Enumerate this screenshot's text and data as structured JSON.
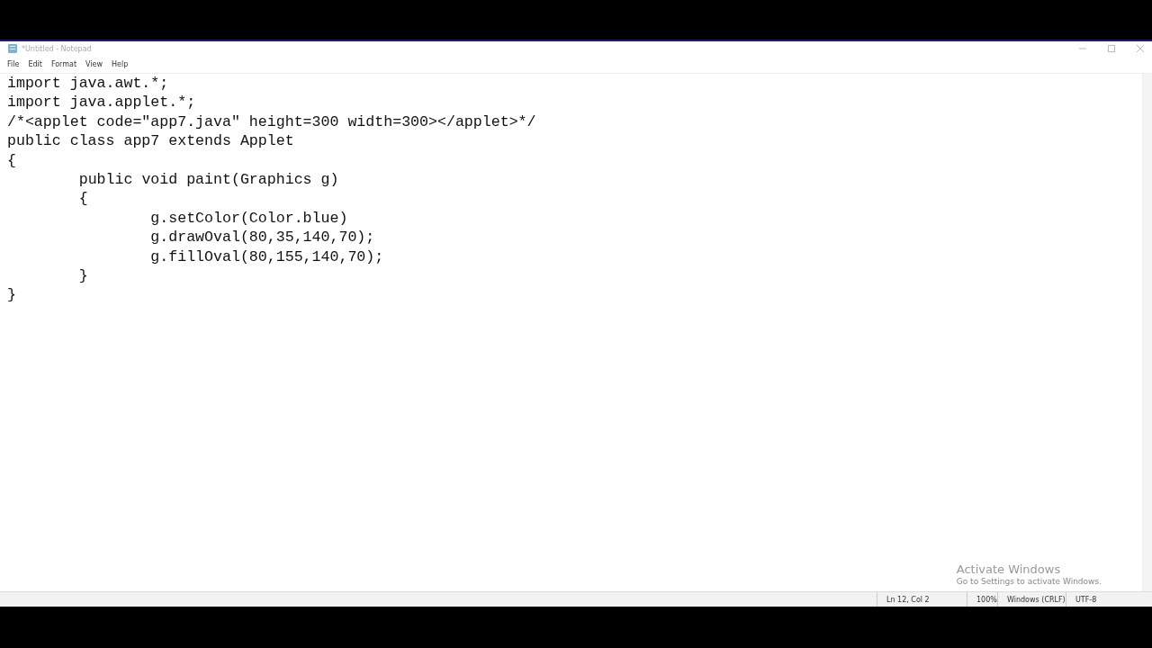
{
  "window": {
    "title": "*Untitled - Notepad"
  },
  "menu": [
    {
      "label": "File"
    },
    {
      "label": "Edit"
    },
    {
      "label": "Format"
    },
    {
      "label": "View"
    },
    {
      "label": "Help"
    }
  ],
  "editor": {
    "lines": [
      "import java.awt.*;",
      "import java.applet.*;",
      "/*<applet code=\"app7.java\" height=300 width=300></applet>*/",
      "public class app7 extends Applet",
      "{",
      "\tpublic void paint(Graphics g)",
      "\t{",
      "\t\tg.setColor(Color.blue)",
      "\t\tg.drawOval(80,35,140,70);",
      "\t\tg.fillOval(80,155,140,70);",
      "\t}",
      "}"
    ]
  },
  "activation_notice": {
    "title": "Activate Windows",
    "subtitle": "Go to Settings to activate Windows."
  },
  "status_bar": {
    "position": "Ln 12, Col 2",
    "zoom": "100%",
    "line_ending": "Windows (CRLF)",
    "encoding": "UTF-8"
  }
}
